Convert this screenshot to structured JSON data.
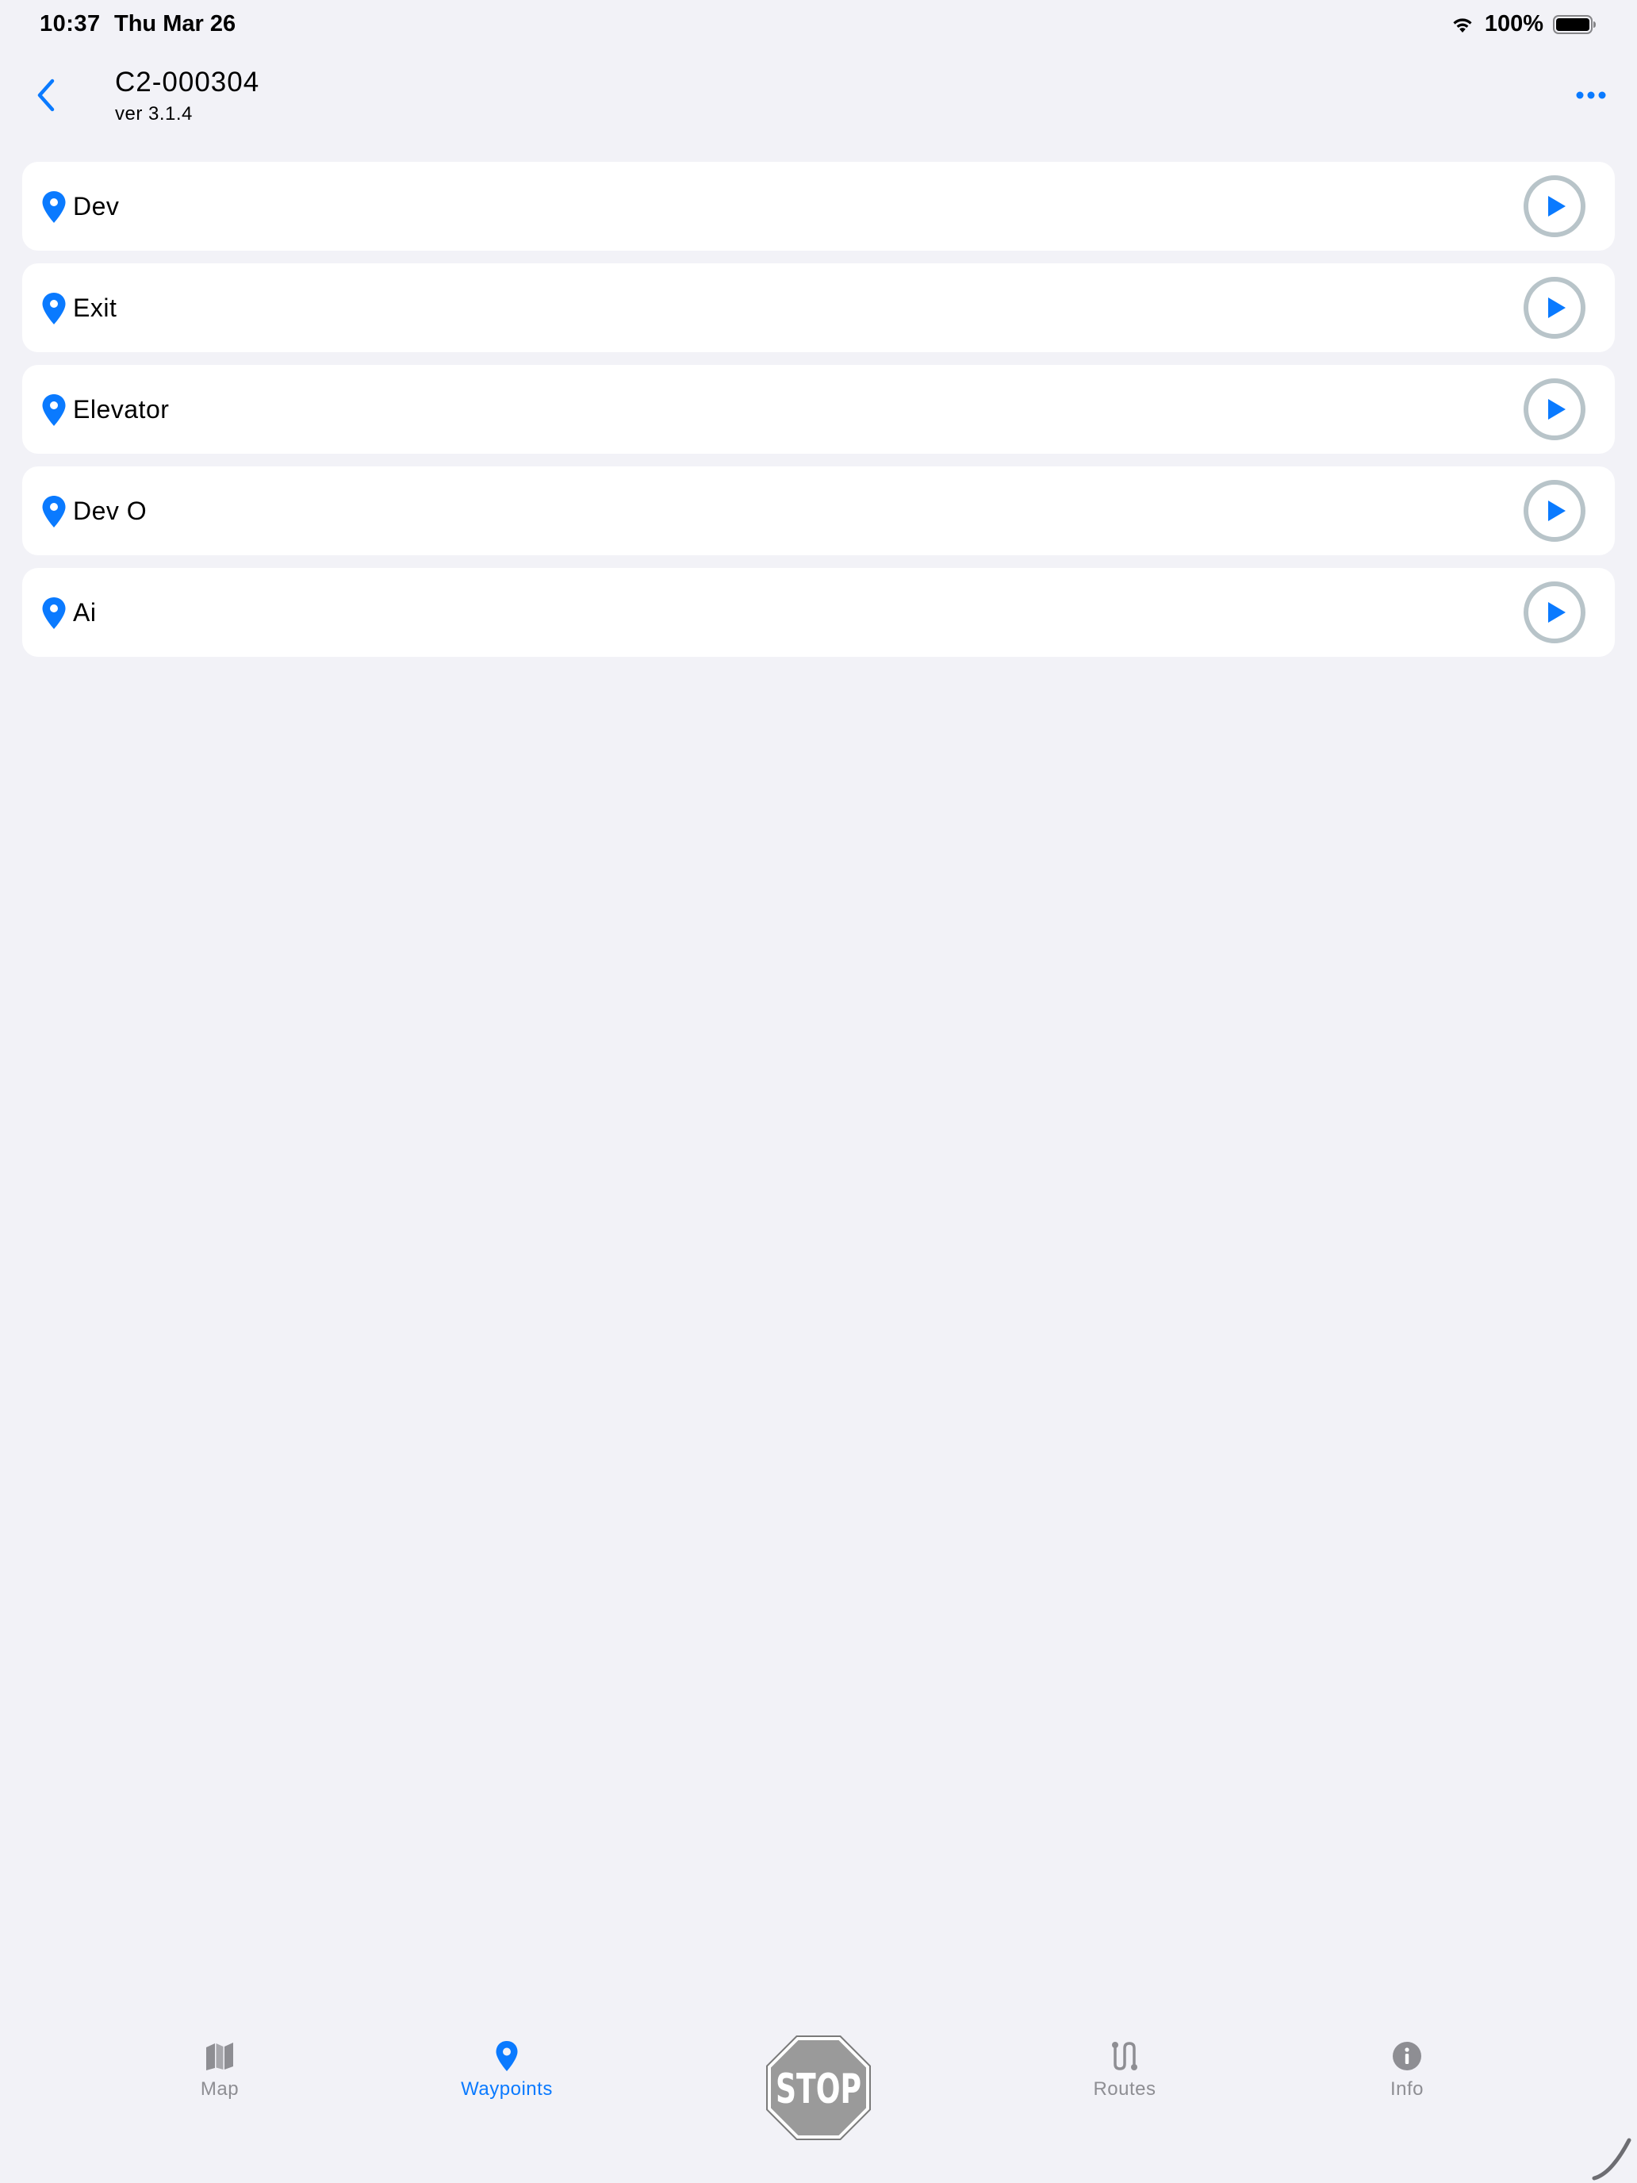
{
  "status_bar": {
    "time": "10:37",
    "date": "Thu Mar 26",
    "battery_percent": "100%"
  },
  "header": {
    "title": "C2-000304",
    "version": "ver 3.1.4"
  },
  "waypoints": [
    {
      "name": "Dev"
    },
    {
      "name": "Exit"
    },
    {
      "name": "Elevator"
    },
    {
      "name": "Dev O"
    },
    {
      "name": "Ai"
    }
  ],
  "tab_bar": {
    "map_label": "Map",
    "waypoints_label": "Waypoints",
    "stop_label": "STOP",
    "routes_label": "Routes",
    "info_label": "Info",
    "active_tab": "Waypoints"
  },
  "colors": {
    "accent": "#0a7aff",
    "background": "#f2f2f7",
    "row_background": "#ffffff",
    "inactive_tab": "#8e8e93",
    "play_ring": "#b8c4c9",
    "stop_sign": "#9a9a9a"
  }
}
